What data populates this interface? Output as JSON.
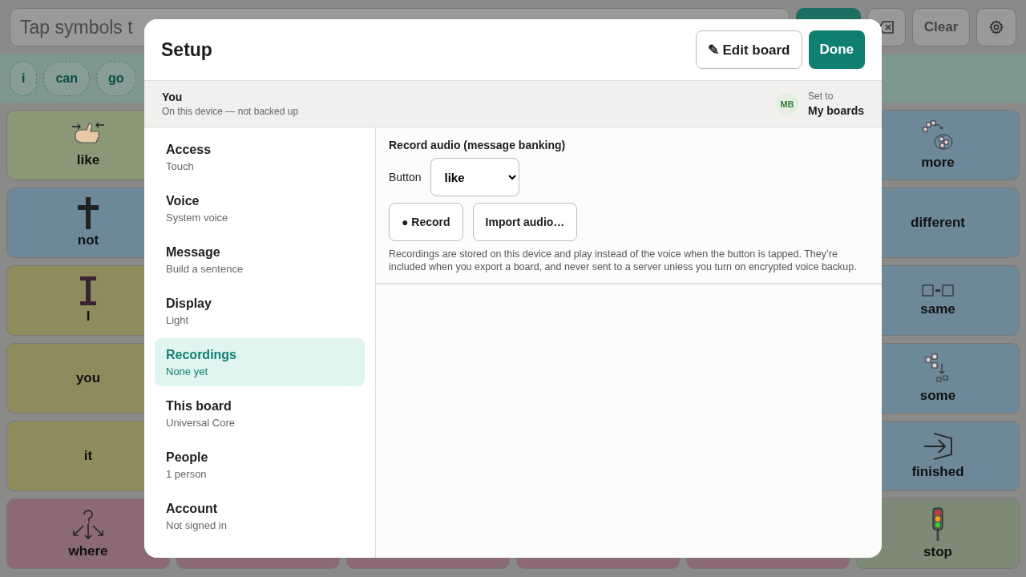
{
  "top_bar": {
    "message_field": {
      "placeholder": "Tap symbols t"
    },
    "clear_label": "Clear"
  },
  "sentence": {
    "chips": [
      "i",
      "can",
      "go"
    ]
  },
  "board": {
    "left_column": [
      {
        "label": "like",
        "color": "#8b9878",
        "kind": "hand"
      },
      {
        "label": "not",
        "color": "#6d8898",
        "kind": "cross"
      },
      {
        "label": "I",
        "color": "#908b5c",
        "kind": "letter"
      },
      {
        "label": "you",
        "color": "#908b5c",
        "kind": "plain"
      },
      {
        "label": "it",
        "color": "#908b5c",
        "kind": "plain"
      },
      {
        "label": "where",
        "color": "#8c6a74",
        "kind": "arrows"
      }
    ],
    "right_column": [
      {
        "label": "more",
        "color": "#6d8898",
        "kind": "gather"
      },
      {
        "label": "different",
        "color": "#6d8898",
        "kind": "plain"
      },
      {
        "label": "same",
        "color": "#6d8898",
        "kind": "equal"
      },
      {
        "label": "some",
        "color": "#6d8898",
        "kind": "split"
      },
      {
        "label": "finished",
        "color": "#6d8898",
        "kind": "exit"
      },
      {
        "label": "stop",
        "color": "#7d8a76",
        "kind": "signal"
      }
    ],
    "bottom_row": [
      {
        "color": "#8c6a74"
      },
      {
        "color": "#8c6a74"
      },
      {
        "color": "#8c6a74"
      },
      {
        "color": "#8c6a74"
      }
    ]
  },
  "dialog": {
    "title": "Setup",
    "edit_button": {
      "icon": "✎",
      "label": "Edit board"
    },
    "done_button": "Done",
    "profile": {
      "name": "You",
      "status": "On this device — not backed up",
      "initials": "MB",
      "set_to_label": "Set to",
      "set_to_value": "My boards"
    },
    "sidebar": {
      "items": [
        {
          "title": "Access",
          "subtitle": "Touch",
          "selected": false
        },
        {
          "title": "Voice",
          "subtitle": "System voice",
          "selected": false
        },
        {
          "title": "Message",
          "subtitle": "Build a sentence",
          "selected": false
        },
        {
          "title": "Display",
          "subtitle": "Light",
          "selected": false
        },
        {
          "title": "Recordings",
          "subtitle": "None yet",
          "selected": true
        },
        {
          "title": "This board",
          "subtitle": "Universal Core",
          "selected": false
        },
        {
          "title": "People",
          "subtitle": "1 person",
          "selected": false
        },
        {
          "title": "Account",
          "subtitle": "Not signed in",
          "selected": false
        }
      ]
    },
    "recordings": {
      "heading": "Record audio (message banking)",
      "button_label": "Button",
      "button_value": "like",
      "record_button": {
        "icon": "●",
        "label": "Record"
      },
      "import_button": "Import audio…",
      "note": "Recordings are stored on this device and play instead of the voice when the button is tapped. They’re included when you export a board, and never sent to a server unless you turn on encrypted voice backup."
    }
  }
}
